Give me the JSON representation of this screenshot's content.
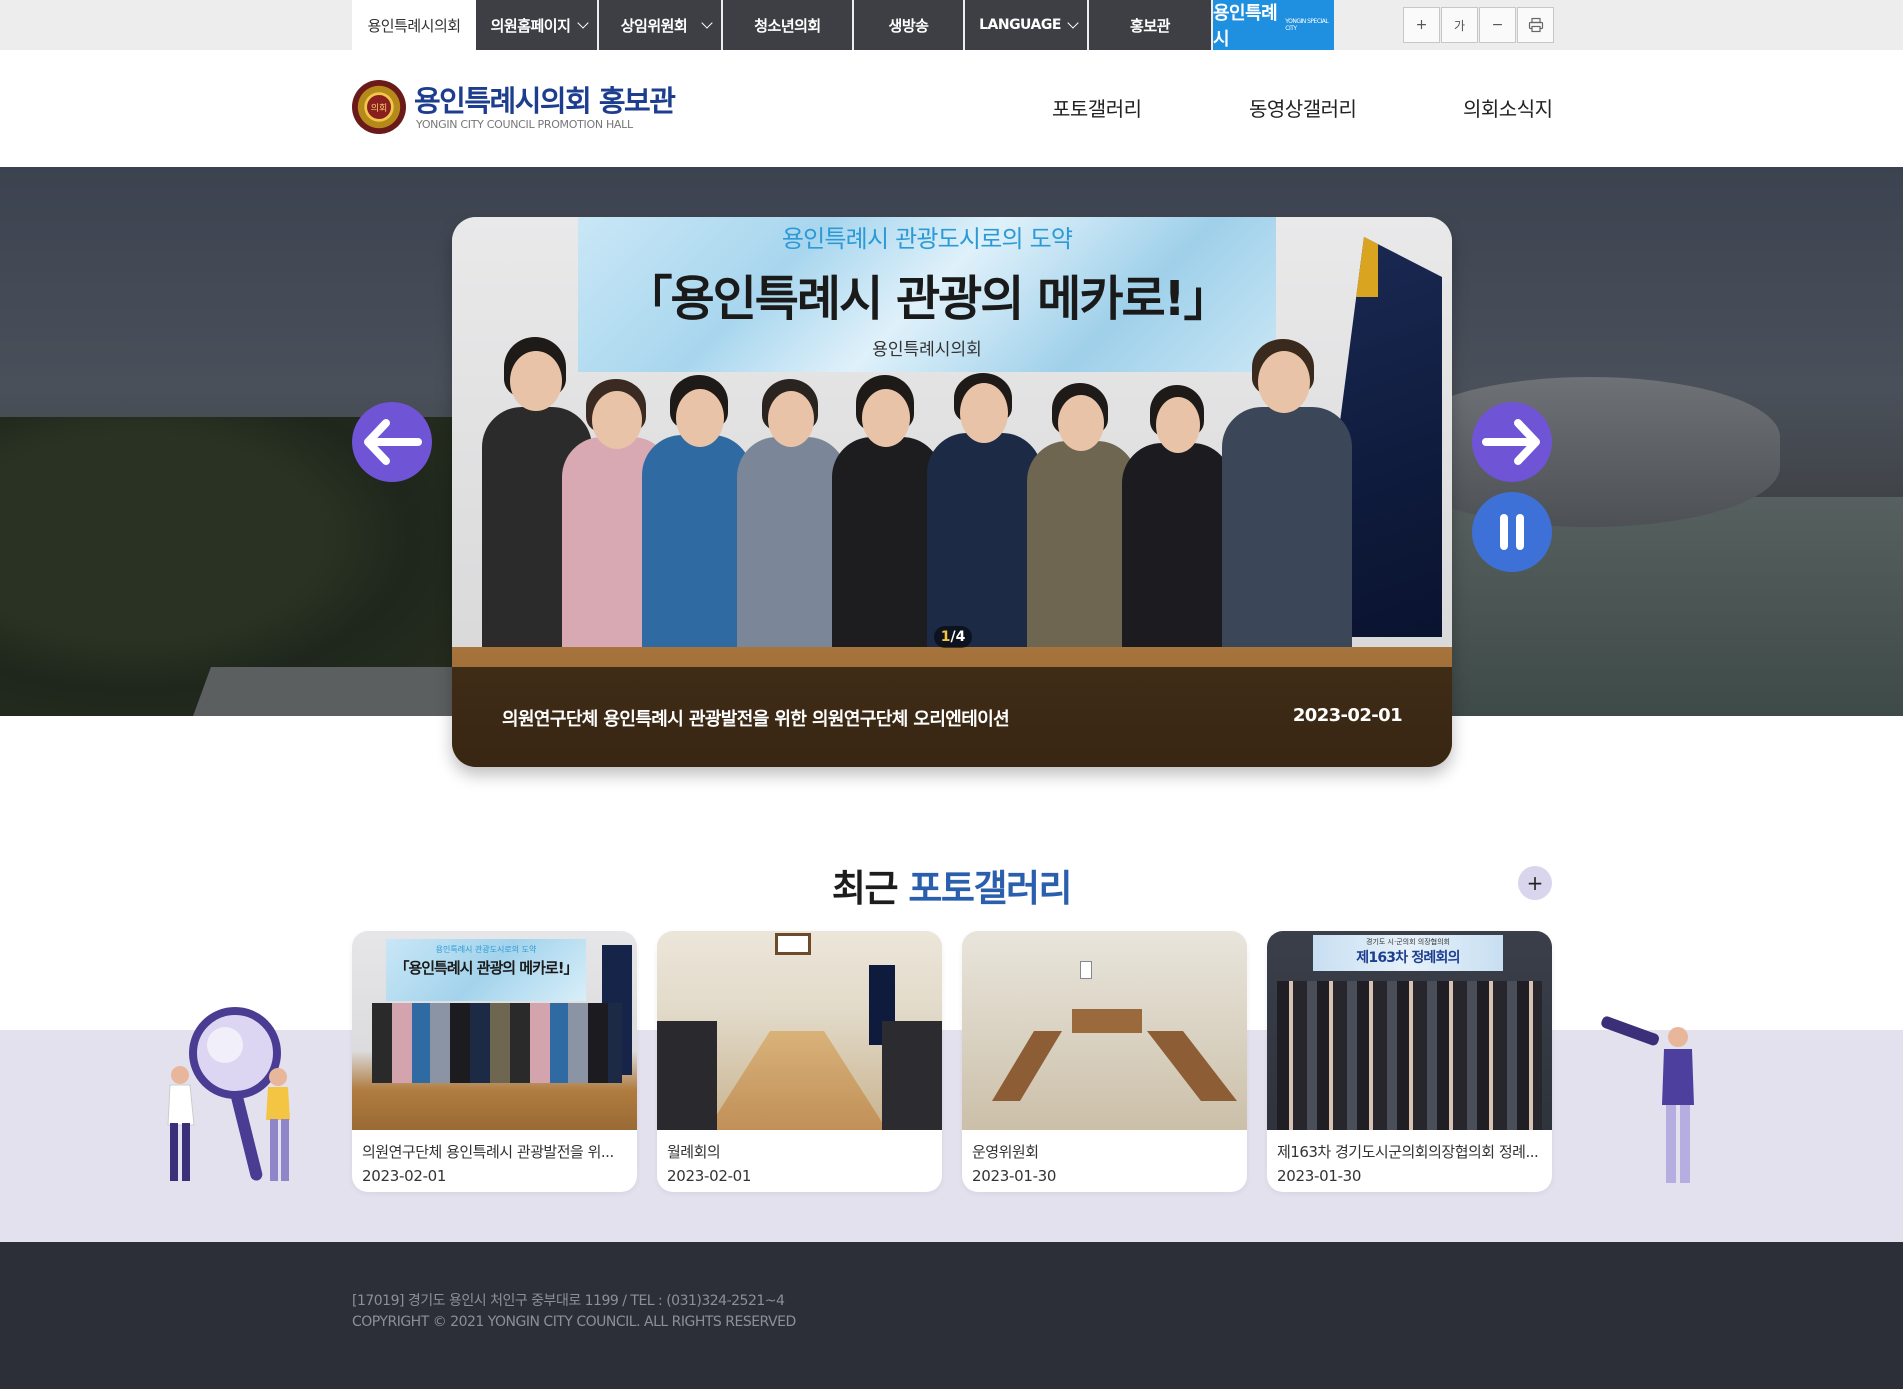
{
  "topnav": {
    "items": [
      {
        "label": "용인특례시의회"
      },
      {
        "label": "의원홈페이지"
      },
      {
        "label": "상임위원회"
      },
      {
        "label": "청소년의회"
      },
      {
        "label": "생방송"
      },
      {
        "label": "LANGUAGE"
      },
      {
        "label": "홍보관"
      }
    ],
    "brand_label": "용인특례시",
    "brand_small": "YONGIN SPECIAL CITY",
    "tools": [
      "+",
      "가",
      "−",
      "print-icon"
    ]
  },
  "header": {
    "logo_emblem_text": "의회",
    "title": "용인특례시의회 홍보관",
    "subtitle": "YONGIN CITY COUNCIL PROMOTION HALL",
    "nav": [
      {
        "label": "포토갤러리"
      },
      {
        "label": "동영상갤러리"
      },
      {
        "label": "의회소식지"
      }
    ]
  },
  "slider": {
    "banner_line1": "용인특례시 관광도시로의 도약",
    "banner_line2": "「용인특례시 관광의 메카로!」",
    "banner_line3": "용인특례시의회",
    "counter_current": "1",
    "counter_sep": "/",
    "counter_total": "4",
    "caption": "의원연구단체 용인특례시 관광발전을 위한 의원연구단체 오리엔테이션",
    "date": "2023-02-01",
    "prev_icon": "arrow-left-icon",
    "next_icon": "arrow-right-icon",
    "pause_icon": "pause-icon"
  },
  "gallery": {
    "title_plain": "최근",
    "title_accent": "포토갤러리",
    "more_label": "+",
    "cards": [
      {
        "title": "의원연구단체 용인특례시 관광발전을 위...",
        "date": "2023-02-01"
      },
      {
        "title": "월례회의",
        "date": "2023-02-01"
      },
      {
        "title": "운영위원회",
        "date": "2023-01-30"
      },
      {
        "title": "제163차 경기도시군의회의장협의회 정례...",
        "date": "2023-01-30"
      }
    ],
    "card1_banner_small": "용인특례시 관광도시로의 도약",
    "card1_banner_big": "「용인특례시 관광의 메카로!」",
    "card4_banner_small": "경기도 시·군의회 의장협의회",
    "card4_banner_big": "제163차 정례회의"
  },
  "footer": {
    "address": "[17019] 경기도 용인시 처인구 중부대로 1199 / TEL : (031)324-2521~4",
    "copyright": "COPYRIGHT © 2021 YONGIN CITY COUNCIL. ALL RIGHTS RESERVED"
  },
  "colors": {
    "topnav_dark": "#3d3f44",
    "brand_blue": "#1f8fe0",
    "title_blue": "#1d3e8f",
    "accent_blue": "#2a5fad",
    "slider_purple": "#6f54d6",
    "slider_blue": "#3e71d8",
    "lavender": "#e4e1ef",
    "footer_bg": "#2c2e38"
  }
}
